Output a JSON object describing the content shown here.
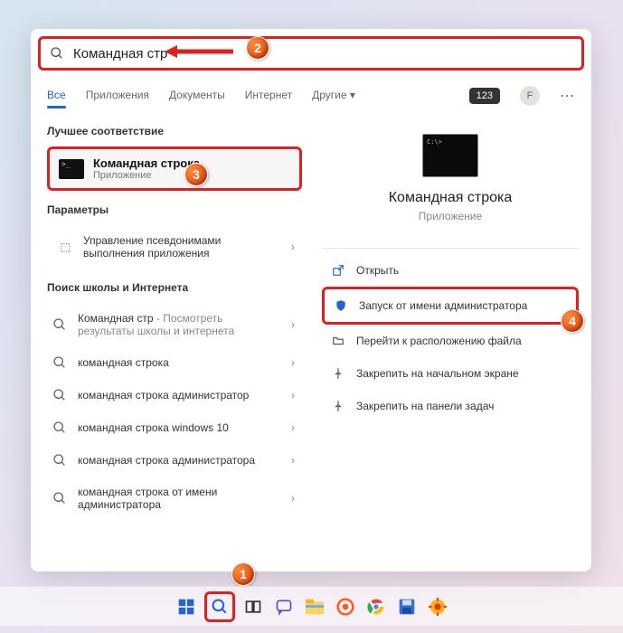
{
  "search": {
    "value": "Командная стр"
  },
  "tabs": [
    "Все",
    "Приложения",
    "Документы",
    "Интернет",
    "Другие ▾"
  ],
  "toolbar": {
    "pill": "123",
    "avatar": "F"
  },
  "left": {
    "bestMatchTitle": "Лучшее соответствие",
    "bestMatch": {
      "title": "Командная строка",
      "subtitle": "Приложение"
    },
    "paramsTitle": "Параметры",
    "paramItem": "Управление псевдонимами выполнения приложения",
    "webTitle": "Поиск школы и Интернета",
    "items": [
      {
        "main": "Командная стр",
        "sub": " - Посмотреть результаты школы и интернета"
      },
      {
        "main": "командная строка",
        "sub": ""
      },
      {
        "main": "командная строка администратор",
        "sub": ""
      },
      {
        "main": "командная строка windows 10",
        "sub": ""
      },
      {
        "main": "командная строка администратора",
        "sub": ""
      },
      {
        "main": "командная строка от имени администратора",
        "sub": ""
      }
    ]
  },
  "right": {
    "title": "Командная строка",
    "subtitle": "Приложение",
    "actions": [
      {
        "icon": "open",
        "label": "Открыть"
      },
      {
        "icon": "admin",
        "label": "Запуск от имени администратора"
      },
      {
        "icon": "folder",
        "label": "Перейти к расположению файла"
      },
      {
        "icon": "pin-start",
        "label": "Закрепить на начальном экране"
      },
      {
        "icon": "pin-task",
        "label": "Закрепить на панели задач"
      }
    ]
  },
  "badges": {
    "b1": "1",
    "b2": "2",
    "b3": "3",
    "b4": "4"
  }
}
